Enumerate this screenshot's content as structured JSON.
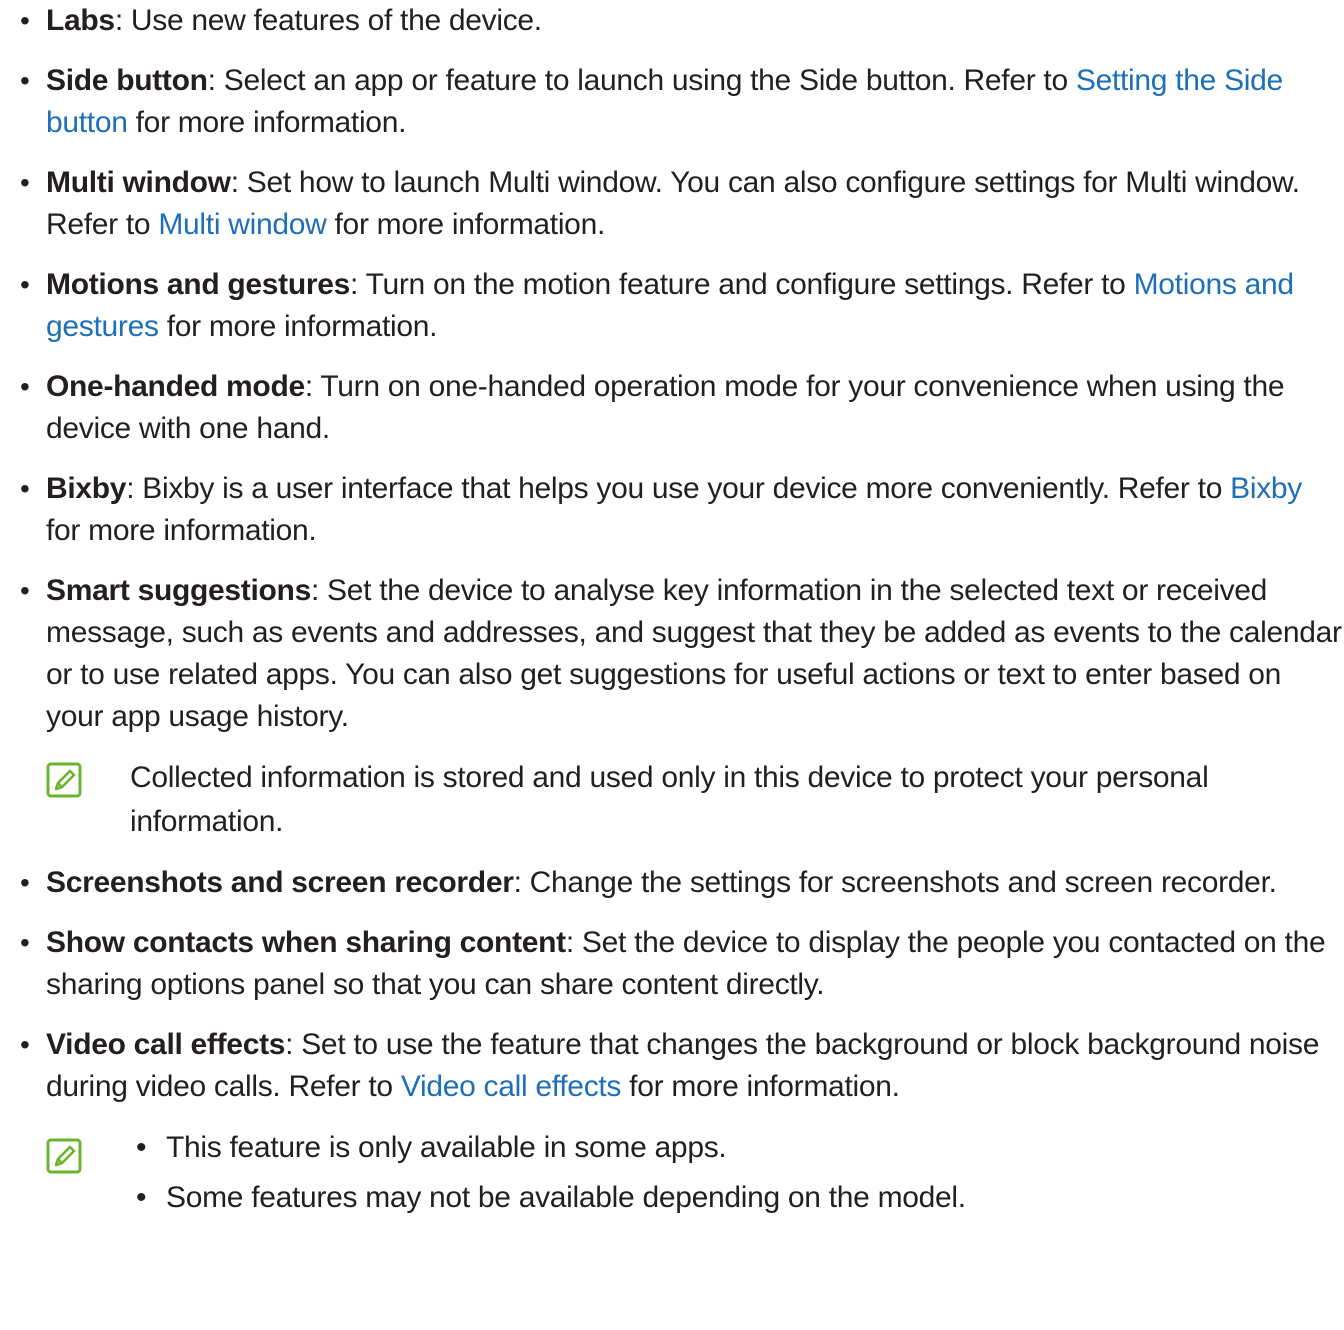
{
  "colors": {
    "text": "#231f20",
    "link": "#1e6fb8",
    "note_icon": "#6bb52c"
  },
  "items": [
    {
      "term": "Labs",
      "pre": ": Use new features of the device.",
      "link": "",
      "post": ""
    },
    {
      "term": "Side button",
      "pre": ": Select an app or feature to launch using the Side button. Refer to ",
      "link": "Setting the Side button",
      "post": " for more information."
    },
    {
      "term": "Multi window",
      "pre": ": Set how to launch Multi window. You can also configure settings for Multi window. Refer to ",
      "link": "Multi window",
      "post": " for more information."
    },
    {
      "term": "Motions and gestures",
      "pre": ": Turn on the motion feature and configure settings. Refer to ",
      "link": "Motions and gestures",
      "post": " for more information."
    },
    {
      "term": "One-handed mode",
      "pre": ": Turn on one-handed operation mode for your convenience when using the device with one hand.",
      "link": "",
      "post": ""
    },
    {
      "term": "Bixby",
      "pre": ": Bixby is a user interface that helps you use your device more conveniently. Refer to ",
      "link": "Bixby",
      "post": " for more information."
    },
    {
      "term": "Smart suggestions",
      "pre": ": Set the device to analyse key information in the selected text or received message, such as events and addresses, and suggest that they be added as events to the calendar or to use related apps. You can also get suggestions for useful actions or text to enter based on your app usage history.",
      "link": "",
      "post": ""
    },
    {
      "term": "Screenshots and screen recorder",
      "pre": ": Change the settings for screenshots and screen recorder.",
      "link": "",
      "post": ""
    },
    {
      "term": "Show contacts when sharing content",
      "pre": ": Set the device to display the people you contacted on the sharing options panel so that you can share content directly.",
      "link": "",
      "post": ""
    },
    {
      "term": "Video call effects",
      "pre": ": Set to use the feature that changes the background or block background noise during video calls. Refer to ",
      "link": "Video call effects",
      "post": " for more information."
    }
  ],
  "notes": {
    "smart_suggestions": "Collected information is stored and used only in this device to protect your personal information.",
    "video_call_effects": [
      "This feature is only available in some apps.",
      "Some features may not be available depending on the model."
    ]
  },
  "bullet_glyph": "•",
  "icon": "note-pencil-icon"
}
